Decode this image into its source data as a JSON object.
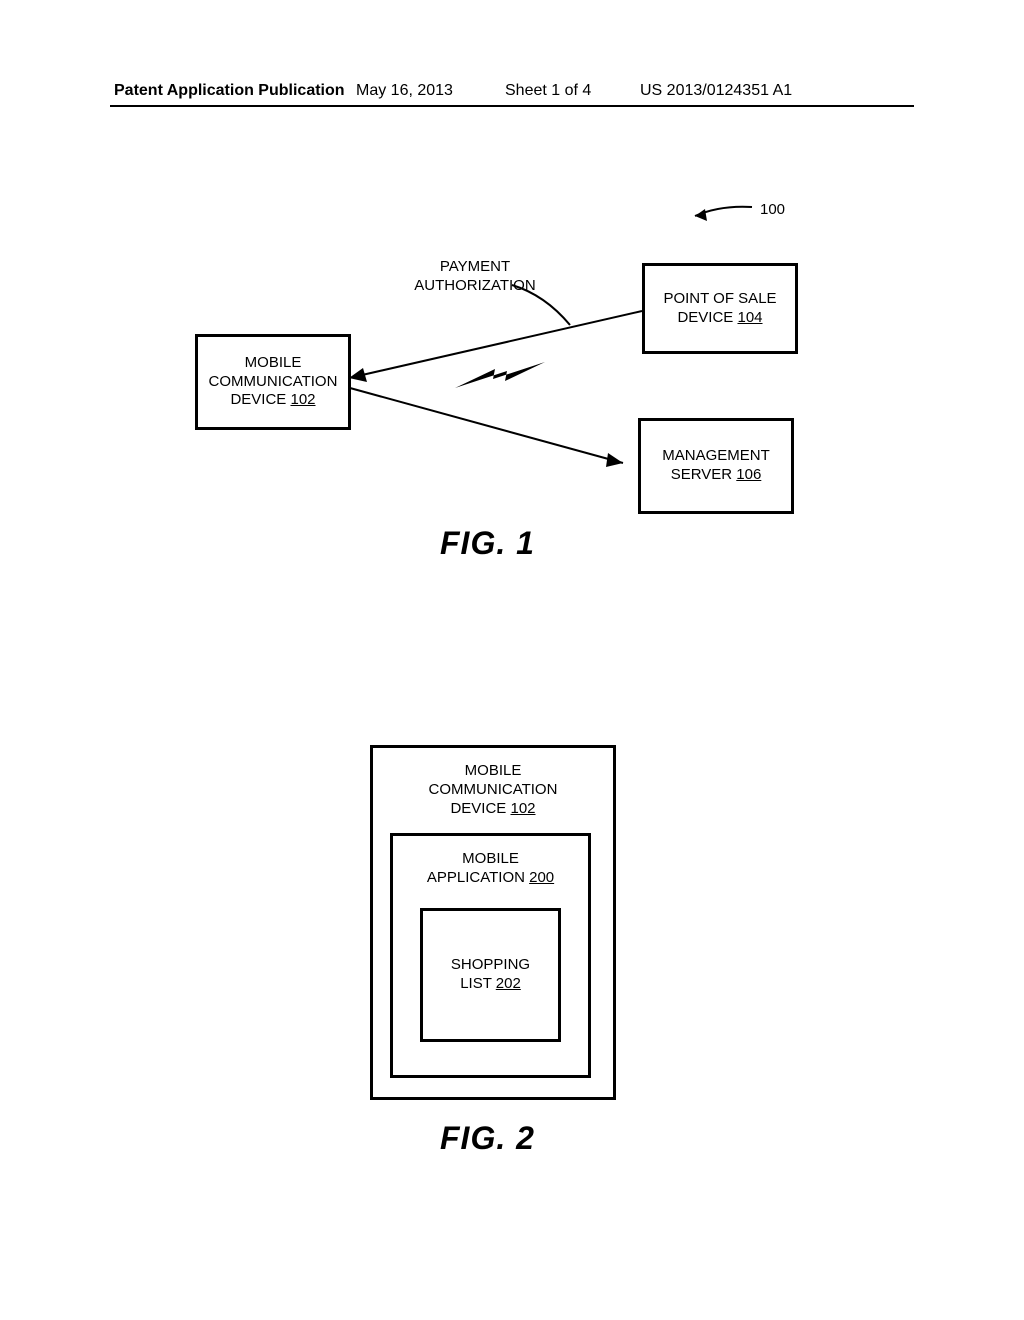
{
  "header": {
    "left": "Patent Application Publication",
    "date": "May 16, 2013",
    "sheet": "Sheet 1 of 4",
    "pubno": "US 2013/0124351 A1"
  },
  "fig1": {
    "ref_label": "100",
    "pa_line1": "PAYMENT",
    "pa_line2": "AUTHORIZATION",
    "mobile_line1": "MOBILE",
    "mobile_line2": "COMMUNICATION",
    "mobile_line3": "DEVICE ",
    "mobile_ref": "102",
    "pos_line1": "POINT OF SALE",
    "pos_line2": "DEVICE ",
    "pos_ref": "104",
    "mgmt_line1": "MANAGEMENT",
    "mgmt_line2": "SERVER ",
    "mgmt_ref": "106",
    "caption": "FIG. 1"
  },
  "fig2": {
    "dev_line1": "MOBILE",
    "dev_line2": "COMMUNICATION",
    "dev_line3": "DEVICE ",
    "dev_ref": "102",
    "app_line1": "MOBILE",
    "app_line2": "APPLICATION ",
    "app_ref": "200",
    "list_line1": "SHOPPING",
    "list_line2": "LIST ",
    "list_ref": "202",
    "caption": "FIG. 2"
  }
}
